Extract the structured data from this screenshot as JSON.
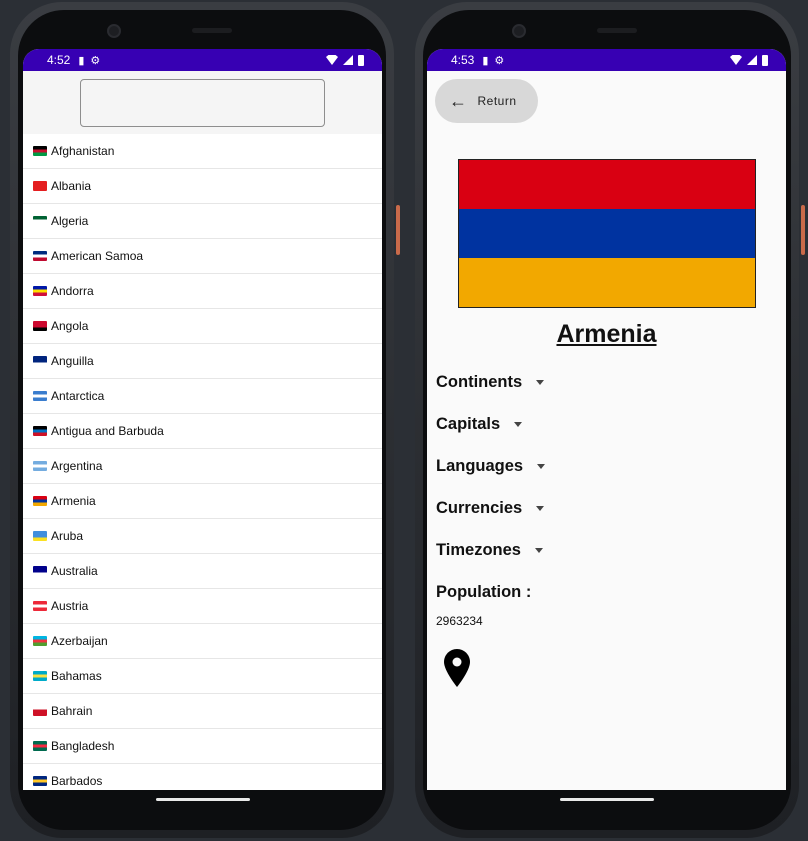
{
  "left_screen": {
    "status": {
      "time": "4:52"
    },
    "search": {
      "placeholder": ""
    },
    "countries": [
      {
        "name": "Afghanistan",
        "colors": [
          "#000000",
          "#c8102e",
          "#009a44"
        ]
      },
      {
        "name": "Albania",
        "colors": [
          "#e41e20",
          "#e41e20",
          "#e41e20"
        ]
      },
      {
        "name": "Algeria",
        "colors": [
          "#006233",
          "#ffffff",
          "#ffffff"
        ]
      },
      {
        "name": "American Samoa",
        "colors": [
          "#002b7f",
          "#ffffff",
          "#bf0a30"
        ]
      },
      {
        "name": "Andorra",
        "colors": [
          "#0018a8",
          "#fedf00",
          "#d0103a"
        ]
      },
      {
        "name": "Angola",
        "colors": [
          "#cc092f",
          "#cc092f",
          "#000000"
        ]
      },
      {
        "name": "Anguilla",
        "colors": [
          "#00247d",
          "#00247d",
          "#ffffff"
        ]
      },
      {
        "name": "Antarctica",
        "colors": [
          "#3a7dce",
          "#ffffff",
          "#3a7dce"
        ]
      },
      {
        "name": "Antigua and Barbuda",
        "colors": [
          "#000000",
          "#0072c6",
          "#ce1126"
        ]
      },
      {
        "name": "Argentina",
        "colors": [
          "#74acdf",
          "#ffffff",
          "#74acdf"
        ]
      },
      {
        "name": "Armenia",
        "colors": [
          "#d90012",
          "#0033a0",
          "#f2a800"
        ]
      },
      {
        "name": "Aruba",
        "colors": [
          "#418fde",
          "#418fde",
          "#fbe122"
        ]
      },
      {
        "name": "Australia",
        "colors": [
          "#00008b",
          "#00008b",
          "#ffffff"
        ]
      },
      {
        "name": "Austria",
        "colors": [
          "#ed2939",
          "#ffffff",
          "#ed2939"
        ]
      },
      {
        "name": "Azerbaijan",
        "colors": [
          "#00b5e2",
          "#ef3340",
          "#509e2f"
        ]
      },
      {
        "name": "Bahamas",
        "colors": [
          "#00abc9",
          "#fae042",
          "#00abc9"
        ]
      },
      {
        "name": "Bahrain",
        "colors": [
          "#ffffff",
          "#ce1126",
          "#ce1126"
        ]
      },
      {
        "name": "Bangladesh",
        "colors": [
          "#006a4e",
          "#f42a41",
          "#006a4e"
        ]
      },
      {
        "name": "Barbados",
        "colors": [
          "#00267f",
          "#ffc726",
          "#00267f"
        ]
      }
    ]
  },
  "right_screen": {
    "status": {
      "time": "4:53"
    },
    "return_label": "Return",
    "country": {
      "name": "Armenia",
      "flag_colors": [
        "#d90012",
        "#0033a0",
        "#f2a800"
      ]
    },
    "sections": {
      "continents": "Continents",
      "capitals": "Capitals",
      "languages": "Languages",
      "currencies": "Currencies",
      "timezones": "Timezones"
    },
    "population_label": "Population :",
    "population_value": "2963234",
    "map_icon": "location-pin-icon"
  },
  "colors": {
    "status_bar": "#3700b3",
    "screen_background": "#fafafa",
    "return_button": "#d8d8d8"
  }
}
